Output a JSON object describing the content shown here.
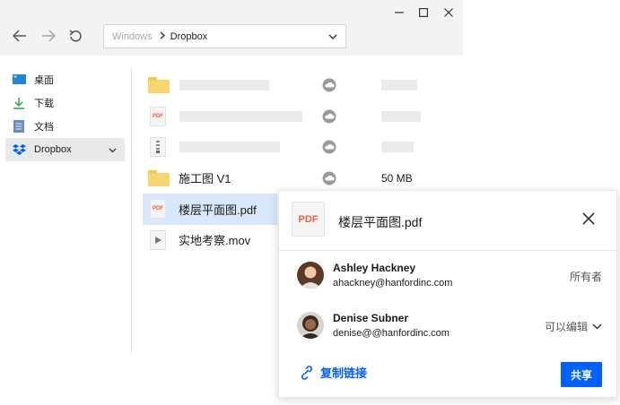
{
  "window": {
    "controls": [
      {
        "name": "minimize",
        "glyph": "—"
      },
      {
        "name": "maximize",
        "glyph": "☐"
      },
      {
        "name": "close",
        "glyph": "✕"
      }
    ]
  },
  "nav": {
    "address": {
      "root": "Windows",
      "current": "Dropbox"
    }
  },
  "sidebar": {
    "items": [
      {
        "label": "桌面",
        "icon": "desktop-icon"
      },
      {
        "label": "下载",
        "icon": "download-icon"
      },
      {
        "label": "文档",
        "icon": "document-icon"
      },
      {
        "label": "Dropbox",
        "icon": "dropbox-icon",
        "active": true
      }
    ]
  },
  "files": {
    "rows": [
      {
        "type": "folder",
        "name": "",
        "size": ""
      },
      {
        "type": "pdf",
        "name": "",
        "size": ""
      },
      {
        "type": "zip",
        "name": "",
        "size": ""
      },
      {
        "type": "folder",
        "name": "施工图 V1",
        "size": "50 MB"
      },
      {
        "type": "pdf",
        "name": "楼层平面图.pdf",
        "size": "",
        "selected": true
      },
      {
        "type": "video",
        "name": "实地考察.mov",
        "size": ""
      }
    ],
    "pdf_badge_text": "PDF"
  },
  "share_panel": {
    "file_badge": "PDF",
    "file_name": "楼层平面图.pdf",
    "people": [
      {
        "name": "Ashley Hackney",
        "email": "ahackney@hanfordinc.com",
        "role": "所有者"
      },
      {
        "name": "Denise Subner",
        "email": "denise@@hanfordinc.com",
        "role": "可以编辑"
      }
    ],
    "copy_link_label": "复制链接",
    "share_button_label": "共享"
  },
  "colors": {
    "accent": "#0061fe",
    "selected_row": "#d8e8fb",
    "folder": "#f7d66b",
    "pdf_text": "#e8613c"
  }
}
